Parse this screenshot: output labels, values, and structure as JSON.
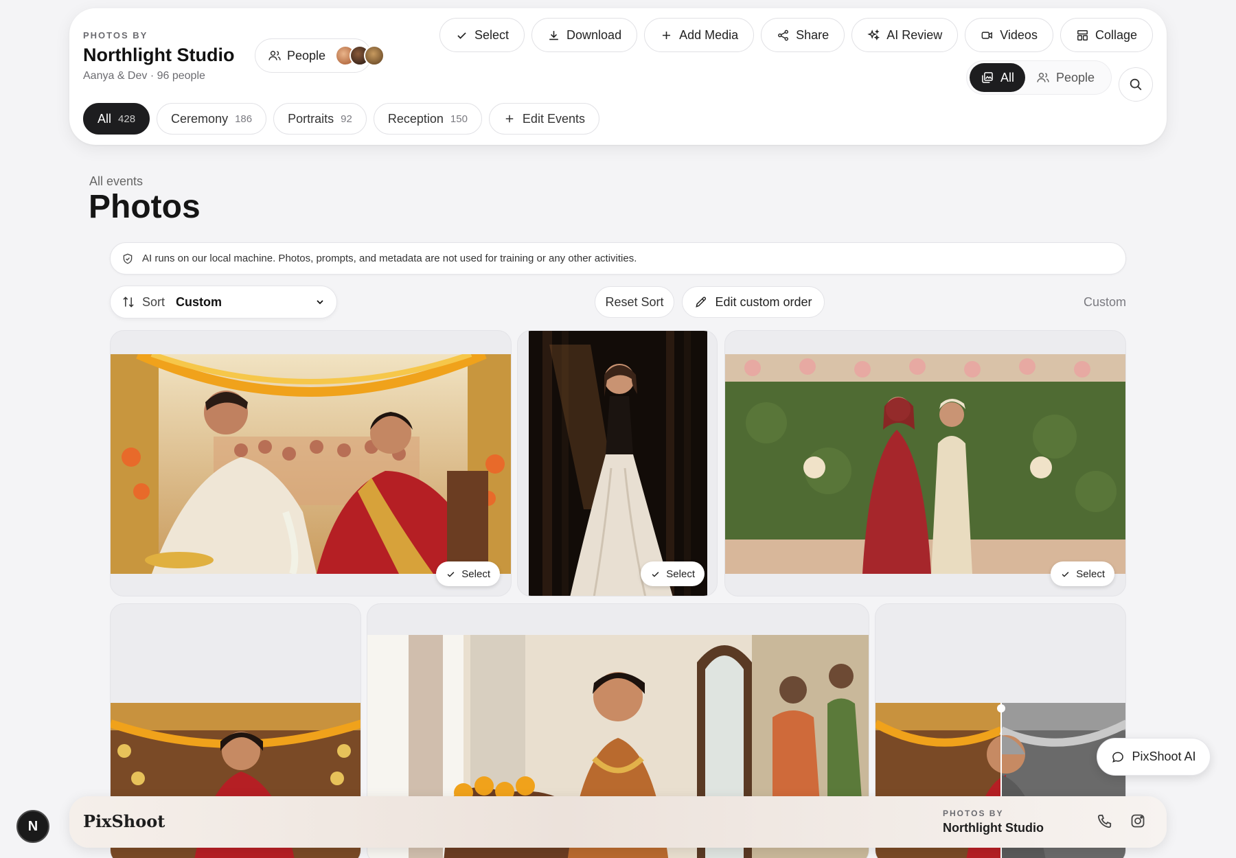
{
  "header": {
    "kicker": "PHOTOS BY",
    "studio_name": "Northlight Studio",
    "subtitle": "Aanya & Dev · 96 people",
    "people_label": "People",
    "toolbar": {
      "select": "Select",
      "download": "Download",
      "add_media": "Add Media",
      "share": "Share",
      "ai_review": "AI Review",
      "videos": "Videos",
      "collage": "Collage"
    },
    "view_toggle": {
      "all": "All",
      "people": "People"
    }
  },
  "events": [
    {
      "label": "All",
      "count": "428"
    },
    {
      "label": "Ceremony",
      "count": "186"
    },
    {
      "label": "Portraits",
      "count": "92"
    },
    {
      "label": "Reception",
      "count": "150"
    }
  ],
  "edit_events_label": "Edit Events",
  "page": {
    "breadcrumb": "All events",
    "title": "Photos",
    "ai_notice": "AI runs on our local machine. Photos, prompts, and metadata are not used for training or any other activities."
  },
  "sort": {
    "label": "Sort",
    "value": "Custom",
    "reset_label": "Reset Sort",
    "edit_order_label": "Edit custom order",
    "mode_label": "Custom"
  },
  "photo_select_label": "Select",
  "footer": {
    "logo": "PixShoot",
    "kicker": "PHOTOS BY",
    "studio_name": "Northlight Studio"
  },
  "assistant_label": "PixShoot AI",
  "badge_letter": "N",
  "colors": {
    "accent_dark": "#1d1d1f",
    "background": "#f4f4f6"
  }
}
